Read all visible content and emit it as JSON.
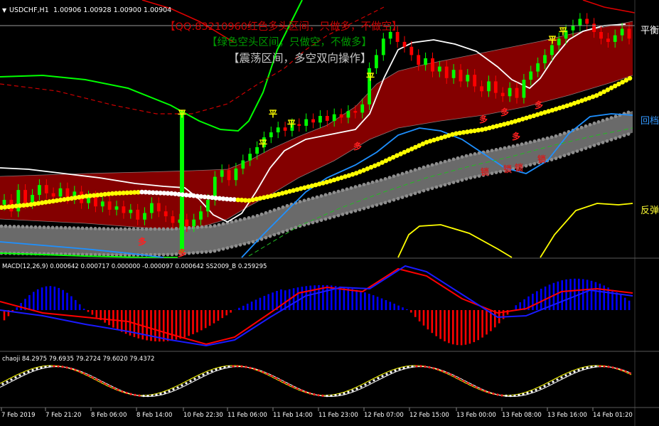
{
  "header": {
    "symbol": "USDCHF,H1",
    "ohlc": "1.00906 1.00928 1.00900 1.00904"
  },
  "overlay_text": {
    "line1": "【QQ:83210960红色多头区间，只做多，不做空】",
    "line2": "【绿色空头区间，只做空，不做多】",
    "line3": "【震荡区间，多空双向操作】"
  },
  "right_labels": {
    "balance": "平衡",
    "pullback": "回档",
    "rebound": "反弹"
  },
  "signal_labels": {
    "flat": "平",
    "long": "多",
    "lock": "锁"
  },
  "indicators": {
    "macd": "MACD(12,26,9) 0.000642 0.000717 0.000000 -0.000097 0.000642  SS2009_B 0.259295",
    "chaoji": "chaoji 84.2975 79.6935 79.2724 79.6020 79.4372"
  },
  "time_axis": [
    "7 Feb 2019",
    "7 Feb 21:20",
    "8 Feb 06:00",
    "8 Feb 14:00",
    "10 Feb 22:30",
    "11 Feb 06:00",
    "11 Feb 14:00",
    "11 Feb 23:00",
    "12 Feb 07:00",
    "12 Feb 15:00",
    "13 Feb 00:00",
    "13 Feb 08:00",
    "13 Feb 16:00",
    "14 Feb 01:20"
  ],
  "colors": {
    "background": "#000000",
    "bull_band": "#8b0000",
    "up_candle": "#00ff00",
    "down_candle": "#ff0000",
    "ma_yellow": "#ffff00",
    "gray_band": "#808080",
    "bb_green": "#00ff00",
    "bb_red": "#ff0000",
    "cyan_line": "#1e90ff",
    "macd_pos": "#0000ff",
    "macd_neg": "#ff0000",
    "line1_color": "#ff0000",
    "line2_color": "#00aa00",
    "line3_color": "#c0c0c0"
  },
  "chart_data": {
    "type": "candlestick",
    "title": "USDCHF,H1",
    "ylim": [
      0.996,
      1.011
    ],
    "close": [
      0.9992,
      0.9985,
      0.9998,
      0.999,
      0.9995,
      1.0001,
      0.9996,
      0.9994,
      0.9999,
      0.9993,
      0.9997,
      0.999,
      0.9994,
      0.9988,
      0.9991,
      0.9986,
      0.9988,
      0.9984,
      0.9986,
      0.998,
      0.9984,
      0.999,
      0.9985,
      0.9982,
      0.9978,
      0.998,
      0.9976,
      0.998,
      0.9985,
      0.9992,
      1.0006,
      1.001,
      1.0004,
      1.0011,
      1.0016,
      1.002,
      1.0024,
      1.003,
      1.0033,
      1.0036,
      1.0034,
      1.0038,
      1.0037,
      1.0041,
      1.0039,
      1.0043,
      1.004,
      1.0044,
      1.0042,
      1.0046,
      1.0045,
      1.005,
      1.0072,
      1.008,
      1.009,
      1.0094,
      1.0088,
      1.0085,
      1.008,
      1.0074,
      1.0078,
      1.007,
      1.0073,
      1.0066,
      1.0071,
      1.0064,
      1.0068,
      1.0061,
      1.0058,
      1.0064,
      1.0057,
      1.0055,
      1.006,
      1.0054,
      1.0065,
      1.007,
      1.0075,
      1.008,
      1.0086,
      1.009,
      1.0095,
      1.0098,
      1.0102,
      1.0099,
      1.0094,
      1.009,
      1.0088,
      1.0092,
      1.0096,
      1.009
    ]
  }
}
